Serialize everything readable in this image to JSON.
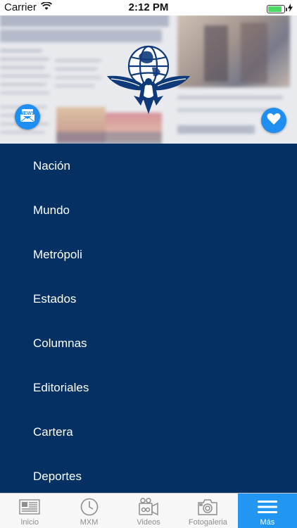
{
  "status_bar": {
    "carrier": "Carrier",
    "time": "2:12 PM",
    "battery_level": 0.85,
    "signal_icon": "wifi-icon",
    "charging_icon": "bolt-icon"
  },
  "hero": {
    "logo_icon": "eagle-globe-logo",
    "left_action_icon": "newsletter-icon",
    "right_action_icon": "heart-icon"
  },
  "menu": {
    "items": [
      {
        "label": "Nación"
      },
      {
        "label": "Mundo"
      },
      {
        "label": "Metrópoli"
      },
      {
        "label": "Estados"
      },
      {
        "label": "Columnas"
      },
      {
        "label": "Editoriales"
      },
      {
        "label": "Cartera"
      },
      {
        "label": "Deportes"
      }
    ]
  },
  "tabbar": {
    "tabs": [
      {
        "label": "Inicio",
        "icon": "newspaper-icon"
      },
      {
        "label": "MXM",
        "icon": "clock-icon"
      },
      {
        "label": "Videos",
        "icon": "video-camera-icon"
      },
      {
        "label": "Fotogaleria",
        "icon": "photo-camera-icon"
      },
      {
        "label": "Más",
        "icon": "hamburger-menu-icon"
      }
    ],
    "active_index": 4
  },
  "colors": {
    "menu_background": "#043063",
    "accent": "#2196f3",
    "fab": "#1e8ff0"
  }
}
